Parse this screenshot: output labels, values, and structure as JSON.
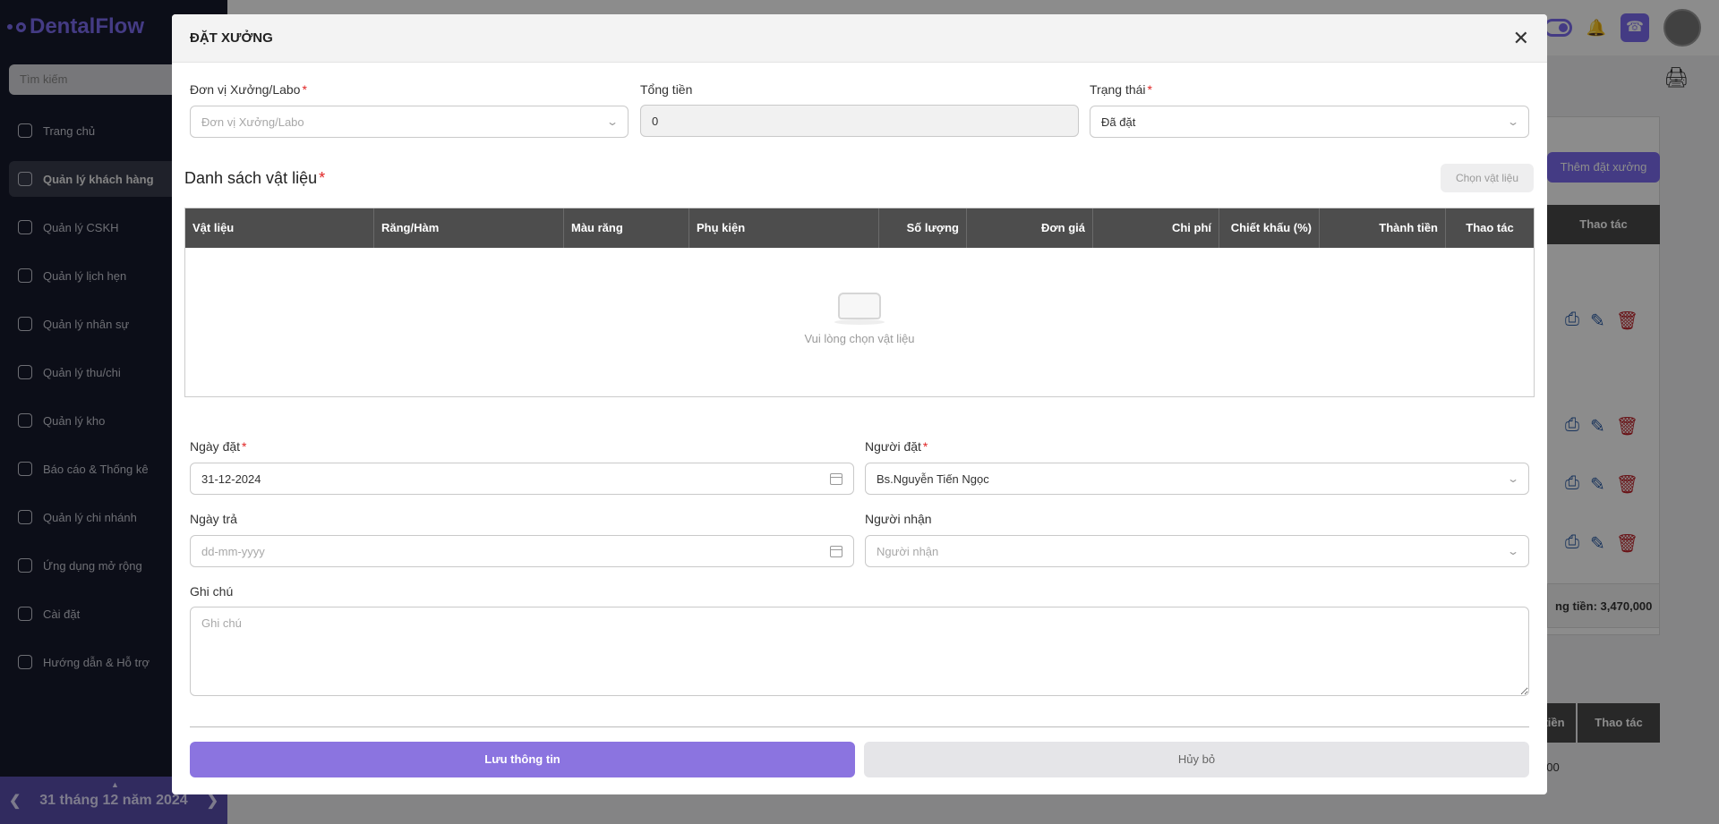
{
  "app": {
    "logo": "DentalFlow",
    "search_placeholder": "Tìm kiếm",
    "sidebar_items": [
      {
        "label": "Trang chủ",
        "icon": "home-icon",
        "active": false
      },
      {
        "label": "Quản lý khách hàng",
        "icon": "user-icon",
        "active": true
      },
      {
        "label": "Quản lý CSKH",
        "icon": "care-icon",
        "active": false
      },
      {
        "label": "Quản lý lịch hẹn",
        "icon": "calendar-icon",
        "active": false
      },
      {
        "label": "Quản lý nhân sự",
        "icon": "users-icon",
        "active": false
      },
      {
        "label": "Quản lý thu/chi",
        "icon": "chart-icon",
        "active": false
      },
      {
        "label": "Quản lý kho",
        "icon": "box-icon",
        "active": false
      },
      {
        "label": "Báo cáo & Thống kê",
        "icon": "pie-icon",
        "active": false
      },
      {
        "label": "Quản lý chi nhánh",
        "icon": "briefcase-icon",
        "active": false
      },
      {
        "label": "Ứng dụng mở rộng",
        "icon": "apps-icon",
        "active": false
      },
      {
        "label": "Cài đặt",
        "icon": "gear-icon",
        "active": false
      },
      {
        "label": "Hướng dẫn & Hỗ trợ",
        "icon": "help-icon",
        "active": false
      }
    ],
    "date_nav": "31 tháng 12 năm 2024",
    "bg": {
      "add_button": "Thêm đặt xưởng",
      "actions_header": "Thao tác",
      "total_text": "ng tiền: 3,470,000",
      "th_total": "tiền",
      "th_actions2": "Thao tác",
      "row_value": "000"
    }
  },
  "modal": {
    "title": "ĐẶT XƯỞNG",
    "lab_label": "Đơn vị Xưởng/Labo",
    "lab_placeholder": "Đơn vị Xưởng/Labo",
    "total_label": "Tổng tiền",
    "total_value": "0",
    "status_label": "Trạng thái",
    "status_value": "Đã đặt",
    "materials_title": "Danh sách vật liệu",
    "choose_materials": "Chọn vật liệu",
    "columns": [
      "Vật liệu",
      "Răng/Hàm",
      "Màu răng",
      "Phụ kiện",
      "Số lượng",
      "Đơn giá",
      "Chi phí",
      "Chiết khấu (%)",
      "Thành tiền",
      "Thao tác"
    ],
    "empty_text": "Vui lòng chọn vật liệu",
    "order_date_label": "Ngày đặt",
    "order_date_value": "31-12-2024",
    "orderer_label": "Người đặt",
    "orderer_value": "Bs.Nguyễn Tiến Ngọc",
    "return_date_label": "Ngày trả",
    "return_date_placeholder": "dd-mm-yyyy",
    "receiver_label": "Người nhận",
    "receiver_placeholder": "Người nhận",
    "note_label": "Ghi chú",
    "note_placeholder": "Ghi chú",
    "save_label": "Lưu thông tin",
    "cancel_label": "Hủy bỏ"
  },
  "colors": {
    "accent": "#8b74e0",
    "sidebar": "#171a2c",
    "table_header": "#4d4d4d",
    "required": "#e02424"
  }
}
